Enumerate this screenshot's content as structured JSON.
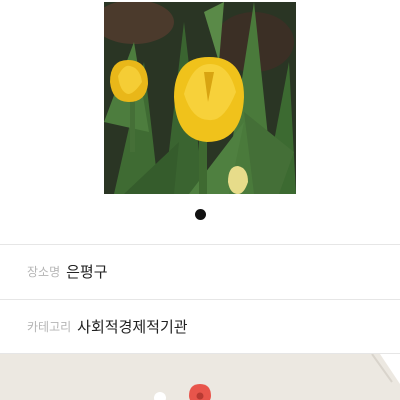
{
  "photo": {
    "icon": "tulip-photo",
    "colors": {
      "petal": "#f2c21a",
      "leaf": "#3e6a32",
      "background": "#2a3524"
    }
  },
  "pager": {
    "active_index": 0,
    "total": 1
  },
  "details": {
    "place_label": "장소명",
    "place_value": "은평구",
    "category_label": "카테고리",
    "category_value": "사회적경제적기관"
  },
  "map": {
    "background_color": "#ece8e1",
    "marker_color": "#e8554b",
    "marker_icon": "map-pin-icon"
  }
}
